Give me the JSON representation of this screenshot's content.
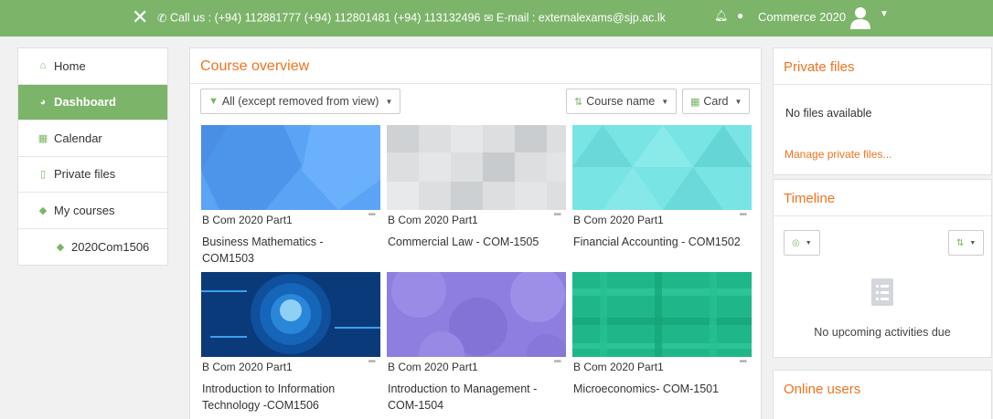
{
  "topbar": {
    "contact": "Call us : (+94) 112881777 (+94) 112801481 (+94) 113132496",
    "email": "E-mail : externalexams@sjp.ac.lk",
    "user_name": "Commerce 2020"
  },
  "nav": {
    "items": [
      {
        "label": "Home"
      },
      {
        "label": "Dashboard"
      },
      {
        "label": "Calendar"
      },
      {
        "label": "Private files"
      },
      {
        "label": "My courses"
      },
      {
        "label": "2020Com1506"
      }
    ]
  },
  "overview": {
    "title": "Course overview",
    "filter": "All (except removed from view)",
    "sort": "Course name",
    "view": "Card",
    "courses": [
      {
        "category": "B Com 2020 Part1",
        "name": "Business Mathematics - COM1503",
        "color": "#5ba3f5"
      },
      {
        "category": "B Com 2020 Part1",
        "name": "Commercial Law - COM-1505",
        "color": "#d6d8da"
      },
      {
        "category": "B Com 2020 Part1",
        "name": "Financial Accounting - COM1502",
        "color": "#79e4e4"
      },
      {
        "category": "B Com 2020 Part1",
        "name": "Introduction to Information Technology -COM1506",
        "color": "#0a3a7a"
      },
      {
        "category": "B Com 2020 Part1",
        "name": "Introduction to Management - COM-1504",
        "color": "#8e7ee0"
      },
      {
        "category": "B Com 2020 Part1",
        "name": "Microeconomics- COM-1501",
        "color": "#1fb78a"
      }
    ]
  },
  "private_files": {
    "title": "Private files",
    "empty": "No files available",
    "manage": "Manage private files..."
  },
  "timeline": {
    "title": "Timeline",
    "empty": "No upcoming activities due"
  },
  "online_users": {
    "title": "Online users"
  },
  "colors": {
    "brand": "#7cb46a",
    "accent": "#f0731f"
  }
}
